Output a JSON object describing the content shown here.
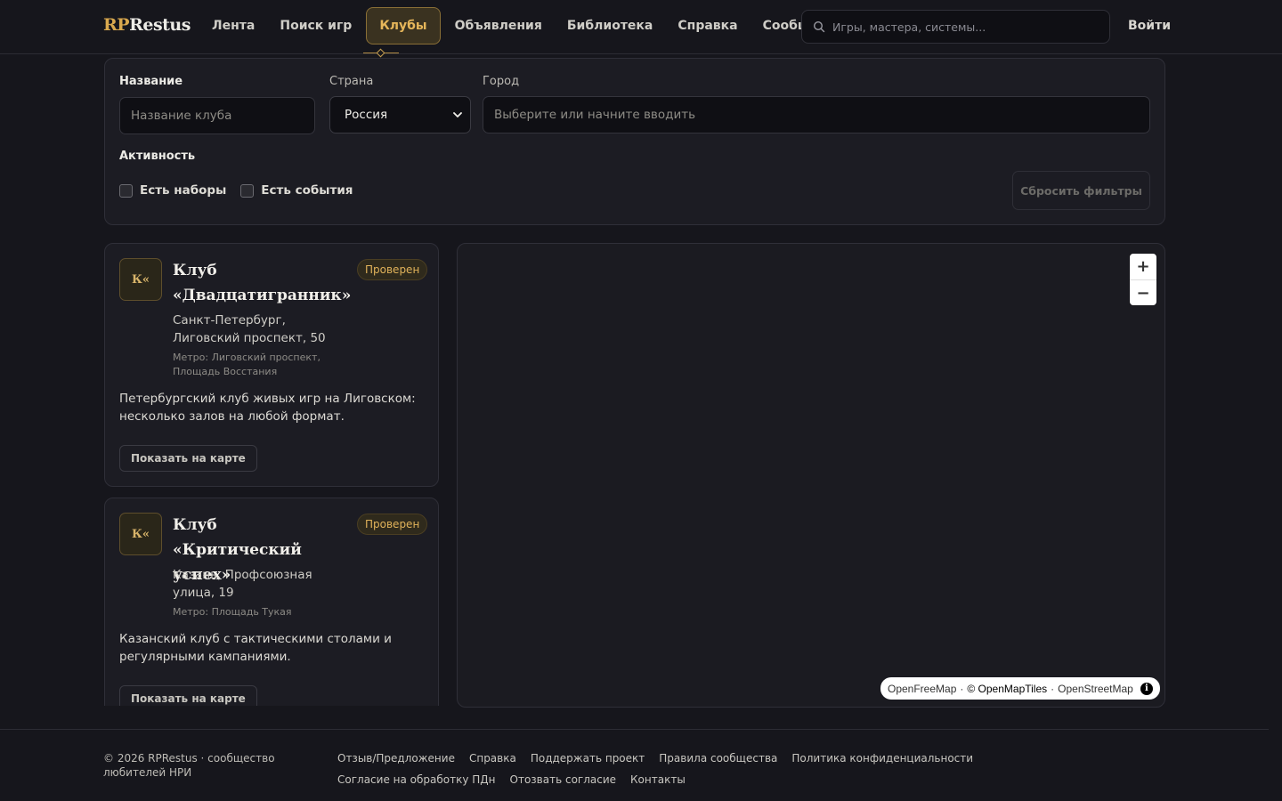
{
  "header": {
    "logo_accent": "RP",
    "logo_rest": "Restus",
    "nav": [
      {
        "label": "Лента"
      },
      {
        "label": "Поиск игр"
      },
      {
        "label": "Клубы",
        "active": true
      },
      {
        "label": "Объявления"
      },
      {
        "label": "Библиотека"
      },
      {
        "label": "Справка"
      },
      {
        "label": "Сообщения"
      }
    ],
    "search_placeholder": "Игры, мастера, системы...",
    "login_label": "Войти"
  },
  "filters": {
    "name_label": "Название",
    "name_placeholder": "Название клуба",
    "country_label": "Страна",
    "country_value": "Россия",
    "city_label": "Город",
    "city_placeholder": "Выберите или начните вводить",
    "activity_label": "Активность",
    "check_recruitment": "Есть наборы",
    "check_events": "Есть события",
    "reset_label": "Сбросить фильтры"
  },
  "clubs": [
    {
      "avatar": "К«",
      "title": "Клуб «Двадцатигранник»",
      "badge": "Проверен",
      "address": "Санкт-Петербург, Лиговский проспект, 50",
      "metro": "Метро: Лиговский проспект, Площадь Восстания",
      "description": "Петербургский клуб живых игр на Лиговском: несколько залов на любой формат.",
      "button": "Показать на карте"
    },
    {
      "avatar": "К«",
      "title": "Клуб «Критический успех»",
      "badge": "Проверен",
      "address": "Казань, Профсоюзная улица, 19",
      "metro": "Метро: Площадь Тукая",
      "description": "Казанский клуб с тактическими столами и регулярными кампаниями.",
      "button": "Показать на карте"
    }
  ],
  "map": {
    "zoom_in": "+",
    "zoom_out": "−",
    "attribution_1": "OpenFreeMap",
    "attribution_2": "© OpenMapTiles",
    "attribution_3": "OpenStreetMap",
    "sep": "·",
    "info": "i"
  },
  "footer": {
    "copyright": "© 2026 RPRestus · сообщество любителей НРИ",
    "links": [
      "Отзыв/Предложение",
      "Справка",
      "Поддержать проект",
      "Правила сообщества",
      "Политика конфиденциальности",
      "Согласие на обработку ПДн",
      "Отозвать согласие",
      "Контакты"
    ]
  },
  "colors": {
    "background": "#16161c",
    "accent": "#d9a84e",
    "panel": "#1c1c23"
  }
}
